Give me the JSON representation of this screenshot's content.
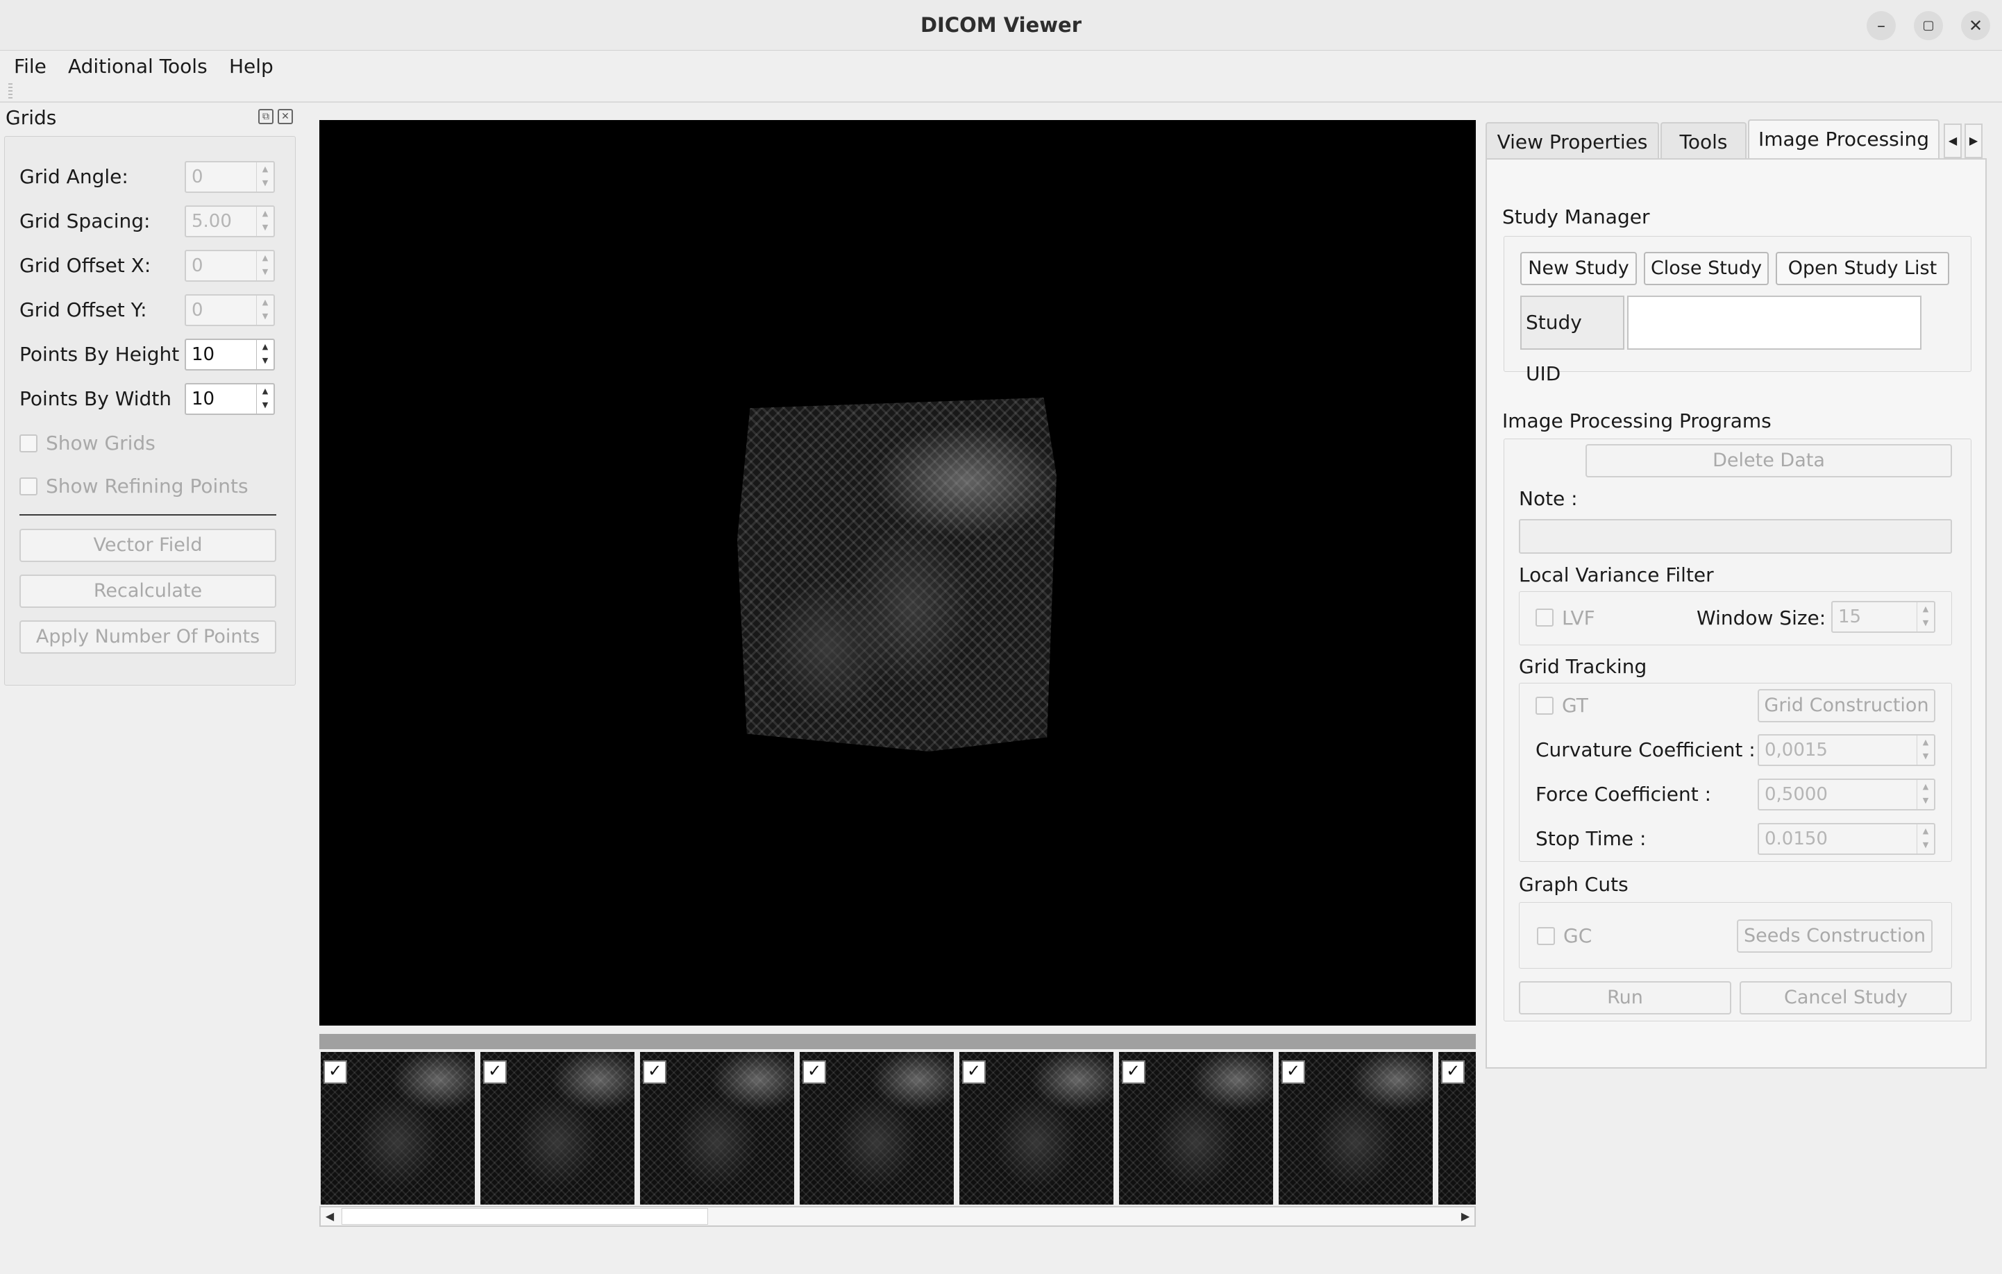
{
  "window": {
    "title": "DICOM Viewer",
    "buttons": [
      "–",
      "▢",
      "✕"
    ]
  },
  "menu": [
    "File",
    "Aditional Tools",
    "Help"
  ],
  "grids_dock": {
    "title": "Grids",
    "fields": [
      {
        "label": "Grid Angle:",
        "value": "0",
        "enabled": false
      },
      {
        "label": "Grid Spacing:",
        "value": "5.00",
        "enabled": false
      },
      {
        "label": "Grid Offset X:",
        "value": "0",
        "enabled": false
      },
      {
        "label": "Grid Offset Y:",
        "value": "0",
        "enabled": false
      },
      {
        "label": "Points By Height",
        "value": "10",
        "enabled": true
      },
      {
        "label": "Points By Width",
        "value": "10",
        "enabled": true
      }
    ],
    "checkboxes": [
      {
        "label": "Show Grids",
        "checked": false
      },
      {
        "label": "Show Refining Points",
        "checked": false
      }
    ],
    "buttons": [
      "Vector Field",
      "Recalculate",
      "Apply Number Of Points"
    ]
  },
  "filmstrip": {
    "thumbnails": [
      {
        "checked": true,
        "selected": true
      },
      {
        "checked": true
      },
      {
        "checked": true
      },
      {
        "checked": true
      },
      {
        "checked": true
      },
      {
        "checked": true
      },
      {
        "checked": true
      },
      {
        "checked": true
      }
    ],
    "check_glyph": "✓",
    "scroll_left": "◀",
    "scroll_right": "▶"
  },
  "right_panel": {
    "tabs": [
      "View Properties",
      "Tools",
      "Image Processing"
    ],
    "active_tab": "Image Processing",
    "tab_scroll": [
      "◀",
      "▶"
    ],
    "study_manager": {
      "title": "Study Manager",
      "buttons": [
        "New Study",
        "Close Study",
        "Open Study List"
      ],
      "uid_label": "Study UID",
      "uid_value": ""
    },
    "programs": {
      "title": "Image Processing Programs",
      "delete_button": "Delete Data",
      "note_label": "Note :",
      "note_value": "",
      "lvf": {
        "title": "Local Variance Filter",
        "checkbox": "LVF",
        "window_size_label": "Window Size:",
        "window_size_value": "15"
      },
      "grid_tracking": {
        "title": "Grid Tracking",
        "checkbox": "GT",
        "construction_button": "Grid Construction",
        "params": [
          {
            "label": "Curvature Coefficient :",
            "value": "0,0015"
          },
          {
            "label": "Force Coefficient :",
            "value": "0,5000"
          },
          {
            "label": "Stop Time :",
            "value": "0.0150"
          }
        ]
      },
      "graph_cuts": {
        "title": "Graph Cuts",
        "checkbox": "GC",
        "seeds_button": "Seeds Construction"
      },
      "run_button": "Run",
      "cancel_button": "Cancel Study"
    }
  }
}
